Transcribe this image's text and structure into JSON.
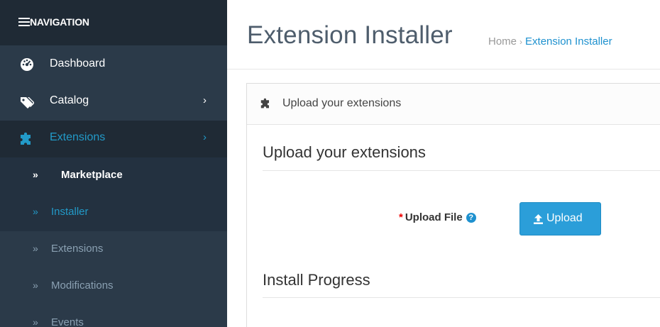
{
  "sidebar": {
    "header": {
      "label": "NAVIGATION",
      "icon": "hamburger-icon"
    },
    "items": [
      {
        "label": "Dashboard",
        "icon": "dashboard-icon"
      },
      {
        "label": "Catalog",
        "icon": "tags-icon",
        "chevron": "›"
      },
      {
        "label": "Extensions",
        "icon": "puzzle-icon",
        "chevron": "›",
        "active": true
      }
    ],
    "sub_items": [
      {
        "label": "Marketplace",
        "arrow": "»"
      },
      {
        "label": "Installer",
        "arrow": "»",
        "active": true
      },
      {
        "label": "Extensions",
        "arrow": "»"
      },
      {
        "label": "Modifications",
        "arrow": "»"
      },
      {
        "label": "Events",
        "arrow": "»"
      }
    ]
  },
  "header": {
    "title": "Extension Installer",
    "breadcrumb": {
      "home": "Home",
      "separator": "›",
      "current": "Extension Installer"
    }
  },
  "panel": {
    "heading": "Upload your extensions",
    "upload_section_title": "Upload your extensions",
    "upload_field": {
      "required_mark": "*",
      "label": "Upload File",
      "help_icon": "?"
    },
    "upload_button_label": "Upload",
    "progress_section_title": "Install Progress"
  },
  "colors": {
    "sidebar_bg": "#2b3a49",
    "sidebar_dark": "#1f2a35",
    "accent": "#229ac8",
    "button": "#2b9ed9",
    "required": "#f00000"
  }
}
